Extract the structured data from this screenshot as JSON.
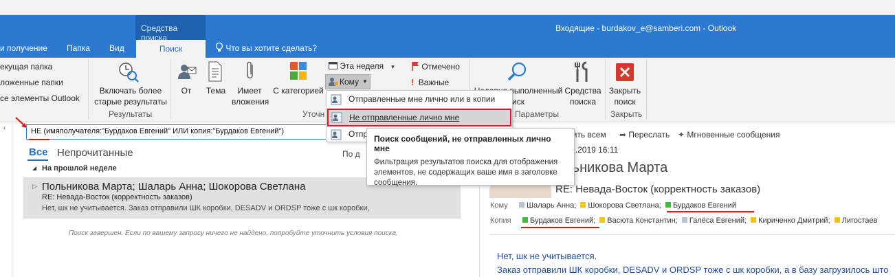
{
  "app": {
    "window_title": "Входящие - burdakov_e@samberi.com - Outlook",
    "context_tab_group": "Средства поиска"
  },
  "tabs": [
    "и получение",
    "Папка",
    "Вид",
    "Поиск"
  ],
  "tell_me": "Что вы хотите сделать?",
  "ribbon": {
    "scope": [
      "екущая папка",
      "ложенные папки",
      "се элементы Outlook"
    ],
    "include_older": "Включать более старые результаты",
    "include_older_l1": "Включать более",
    "include_older_l2": "старые результаты",
    "group_results": "Результаты",
    "from": "От",
    "subject": "Тема",
    "has_attachments_l1": "Имеет",
    "has_attachments_l2": "вложения",
    "categorized": "С категорией",
    "this_week": "Эта неделя",
    "to": "Кому",
    "flagged": "Отмечено",
    "important": "Важные",
    "group_refine": "Уточн",
    "recent_l1": "Недавно выполненный",
    "recent_l2": "иск",
    "search_tools_l1": "Средства",
    "search_tools_l2": "поиска",
    "group_options": "Параметры",
    "close_l1": "Закрыть",
    "close_l2": "поиск",
    "group_close": "Закрыть"
  },
  "dropdown": {
    "items": [
      "Отправленные мне лично или в копии",
      "Не отправленные лично мне",
      "Отпр"
    ]
  },
  "tooltip": {
    "title": "Поиск сообщений, не отправленных лично мне",
    "body": "Фильтрация результатов поиска для отображения элементов, не содержащих ваше имя в заголовке сообщения."
  },
  "search": {
    "query": "НЕ (имяполучателя:\"Бурдаков Евгений\" ИЛИ копия:\"Бурдаков Евгений\")"
  },
  "list": {
    "filter_all": "Все",
    "filter_unread": "Непрочитанные",
    "sort_label": "По д",
    "group_header": "На прошлой неделе",
    "message": {
      "from": "Польникова Марта;  Шаларь Анна;  Шокорова Светлана",
      "subject": "RE: Невада-Восток (корректность заказов)",
      "preview": "Нет, шк не учитывается.  Заказ отправили ШК коробки, DESADV  и ORDSP тоже с шк коробки,"
    },
    "search_complete": "Поиск завершен. Если по вашему запросу ничего не найдено, попробуйте уточнить условия поиска."
  },
  "reading": {
    "reply_all": "етить всем",
    "forward": "Переслать",
    "im": "Мгновенные сообщения",
    "date": ".11.2019 16:11",
    "sender": "льникова Марта",
    "subject": "RE: Невада-Восток (корректность заказов)",
    "to_label": "Кому",
    "to": [
      "Шаларь Анна;",
      "Шокорова Светлана;",
      "Бурдаков Евгений"
    ],
    "cc_label": "Копия",
    "cc": [
      "Бурдаков Евгений;",
      "Васюта Константин;",
      "Галёса Евгений;",
      "Кириченко Дмитрий;",
      "Лигостаев"
    ],
    "body_line1": "Нет, шк не учитывается.",
    "body_line2": "Заказ отправили ШК коробки, DESADV  и ORDSP тоже с шк коробки, а в базу загрузилось што"
  },
  "colors": {
    "accent": "#2b79d0",
    "category_gray": "#b8c4d0",
    "category_yellow": "#f0c419",
    "category_green": "#44b840",
    "annotation_red": "#e11111"
  }
}
